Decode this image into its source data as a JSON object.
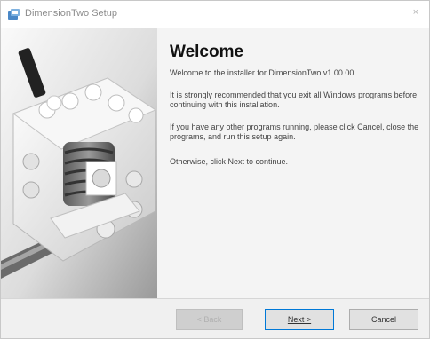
{
  "window": {
    "title": "DimensionTwo Setup",
    "close_glyph": "×"
  },
  "welcome": {
    "heading": "Welcome",
    "paragraphs": [
      "Welcome to the installer for DimensionTwo v1.00.00.",
      "It is strongly recommended that you exit all Windows programs before continuing with this installation.",
      "If you have any other programs running, please click Cancel, close the programs, and run this setup again.",
      "Otherwise, click Next to continue."
    ]
  },
  "buttons": {
    "back_label": "< Back",
    "next_label": "Next >",
    "cancel_label": "Cancel",
    "back_enabled": false
  },
  "side_image": {
    "description_icon": "lego-gear-mechanism-icon"
  },
  "colors": {
    "focus_border": "#0078d7",
    "panel_bg": "#f4f4f4",
    "window_bg": "#f0f0f0"
  }
}
